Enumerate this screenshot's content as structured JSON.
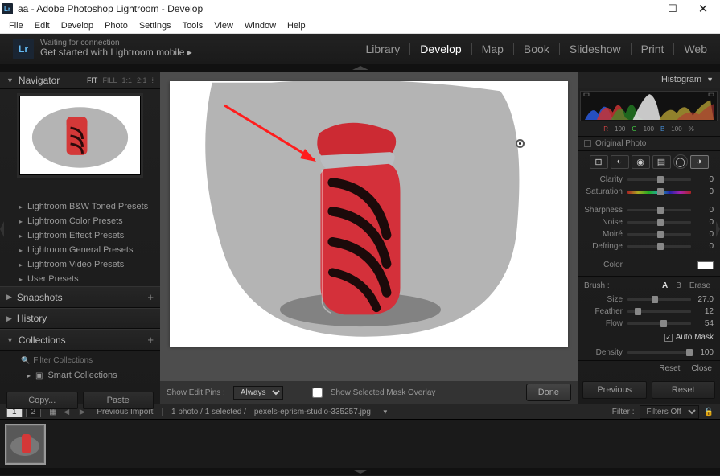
{
  "window": {
    "title": "aa - Adobe Photoshop Lightroom - Develop"
  },
  "menu": {
    "items": [
      "File",
      "Edit",
      "Develop",
      "Photo",
      "Settings",
      "Tools",
      "View",
      "Window",
      "Help"
    ]
  },
  "header": {
    "waiting": "Waiting for connection",
    "getstarted": "Get started with Lightroom mobile  ▸",
    "modules": [
      "Library",
      "Develop",
      "Map",
      "Book",
      "Slideshow",
      "Print",
      "Web"
    ],
    "active_module": "Develop"
  },
  "navigator": {
    "title": "Navigator",
    "zoom": [
      "FIT",
      "FILL",
      "1:1",
      "2:1"
    ],
    "active_zoom": "FIT"
  },
  "presets": {
    "items": [
      {
        "label": "Lightroom B&W Toned Presets"
      },
      {
        "label": "Lightroom Color Presets"
      },
      {
        "label": "Lightroom Effect Presets"
      },
      {
        "label": "Lightroom General Presets"
      },
      {
        "label": "Lightroom Video Presets"
      },
      {
        "label": "User Presets"
      }
    ]
  },
  "sections": {
    "snapshots": "Snapshots",
    "history": "History",
    "collections": "Collections"
  },
  "collections": {
    "filter": "Filter Collections",
    "smart": "Smart Collections"
  },
  "left_buttons": {
    "copy": "Copy...",
    "paste": "Paste"
  },
  "canvas_toolbar": {
    "show_pins": "Show Edit Pins :",
    "always": "Always",
    "overlay": "Show Selected Mask Overlay",
    "done": "Done"
  },
  "histogram": {
    "title": "Histogram",
    "rgb": {
      "r_label": "R",
      "r": "100",
      "g_label": "G",
      "g": "100",
      "b_label": "B",
      "b": "100",
      "pct": "%"
    },
    "original": "Original Photo"
  },
  "sliders": {
    "clarity": {
      "label": "Clarity",
      "val": "0"
    },
    "saturation": {
      "label": "Saturation",
      "val": "0"
    },
    "sharpness": {
      "label": "Sharpness",
      "val": "0"
    },
    "noise": {
      "label": "Noise",
      "val": "0"
    },
    "moire": {
      "label": "Moiré",
      "val": "0"
    },
    "defringe": {
      "label": "Defringe",
      "val": "0"
    },
    "color": {
      "label": "Color"
    }
  },
  "brush": {
    "title": "Brush :",
    "a": "A",
    "b": "B",
    "erase": "Erase",
    "size": {
      "label": "Size",
      "val": "27.0"
    },
    "feather": {
      "label": "Feather",
      "val": "12"
    },
    "flow": {
      "label": "Flow",
      "val": "54"
    },
    "automask": "Auto Mask",
    "density": {
      "label": "Density",
      "val": "100"
    }
  },
  "reset_close": {
    "reset": "Reset",
    "close": "Close"
  },
  "right_buttons": {
    "previous": "Previous",
    "reset": "Reset"
  },
  "status": {
    "view1": "1",
    "view2": "2",
    "prev_import": "Previous Import",
    "count": "1 photo / 1 selected /",
    "filename": "pexels-eprism-studio-335257.jpg",
    "filter_label": "Filter :",
    "filter_value": "Filters Off"
  }
}
